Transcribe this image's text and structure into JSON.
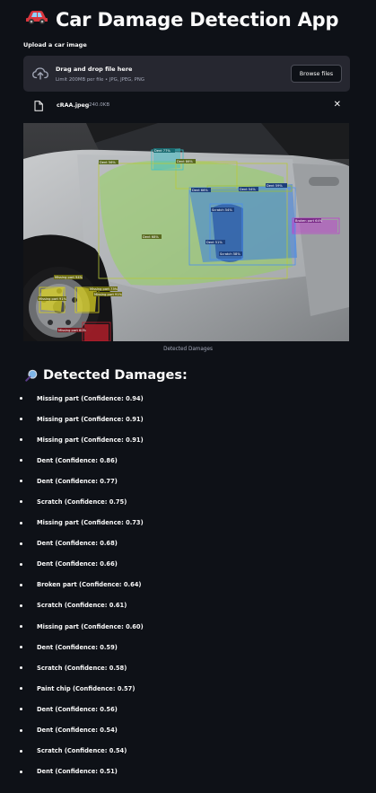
{
  "app": {
    "title_icon": "car-emoji",
    "title": "Car Damage Detection App"
  },
  "uploader": {
    "label": "Upload a car image",
    "drop_title": "Drag and drop file here",
    "limit_text": "Limit 200MB per file • JPG, JPEG, PNG",
    "browse_label": "Browse files",
    "file_name": "cRAA.jpeg",
    "file_size": "240.0KB",
    "close_icon": "close-icon"
  },
  "image": {
    "caption": "Detected Damages",
    "overlay_labels": [
      "Dent 56%",
      "Dent 77%",
      "Dent 86%",
      "Dent 66%",
      "Dent 54%",
      "Dent 59%",
      "Scratch 54%",
      "Scratch 58%",
      "Broken part 64%",
      "Dent 68%",
      "Dent 51%",
      "Missing part 94%",
      "Missing part 73%",
      "Missing part 91%",
      "Missing part 60%",
      "Missing part 91%"
    ]
  },
  "detections": {
    "heading_icon": "magnifier-emoji",
    "heading": "Detected Damages:",
    "items": [
      {
        "type": "Missing part",
        "conf": " (Confidence: 0.94)"
      },
      {
        "type": "Missing part",
        "conf": " (Confidence: 0.91)"
      },
      {
        "type": "Missing part",
        "conf": " (Confidence: 0.91)"
      },
      {
        "type": "Dent",
        "conf": " (Confidence: 0.86)"
      },
      {
        "type": "Dent",
        "conf": " (Confidence: 0.77)"
      },
      {
        "type": "Scratch",
        "conf": " (Confidence: 0.75)"
      },
      {
        "type": "Missing part",
        "conf": " (Confidence: 0.73)"
      },
      {
        "type": "Dent",
        "conf": " (Confidence: 0.68)"
      },
      {
        "type": "Dent",
        "conf": " (Confidence: 0.66)"
      },
      {
        "type": "Broken part",
        "conf": " (Confidence: 0.64)"
      },
      {
        "type": "Scratch",
        "conf": " (Confidence: 0.61)"
      },
      {
        "type": "Missing part",
        "conf": " (Confidence: 0.60)"
      },
      {
        "type": "Dent",
        "conf": " (Confidence: 0.59)"
      },
      {
        "type": "Scratch",
        "conf": " (Confidence: 0.58)"
      },
      {
        "type": "Paint chip",
        "conf": " (Confidence: 0.57)"
      },
      {
        "type": "Dent",
        "conf": " (Confidence: 0.56)"
      },
      {
        "type": "Dent",
        "conf": " (Confidence: 0.54)"
      },
      {
        "type": "Scratch",
        "conf": " (Confidence: 0.54)"
      },
      {
        "type": "Dent",
        "conf": " (Confidence: 0.51)"
      }
    ]
  },
  "colors": {
    "background": "#0e1117",
    "surface": "#262730",
    "text": "#fafafa",
    "muted": "#a3a8b8"
  }
}
